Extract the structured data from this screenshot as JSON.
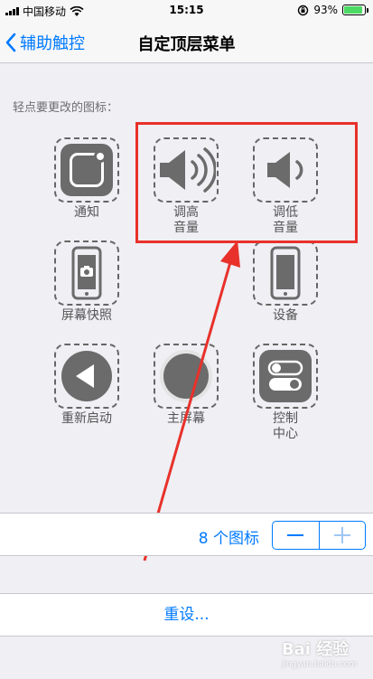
{
  "status_bar": {
    "carrier": "中国移动",
    "time": "15:15",
    "battery": "93%",
    "battery_level": 0.93
  },
  "nav": {
    "back_label": "辅助触控",
    "title": "自定顶层菜单"
  },
  "section_label": "轻点要更改的图标：",
  "icons": {
    "notification": "通知",
    "volume_up": "调高\n音量",
    "volume_down": "调低\n音量",
    "screenshot": "屏幕快照",
    "device": "设备",
    "restart": "重新启动",
    "home": "主屏幕",
    "control_center": "控制\n中心"
  },
  "counter": {
    "label": "8 个图标",
    "minus": "—",
    "plus": "+"
  },
  "reset": "重设...",
  "watermark": {
    "brand": "Bai 经验",
    "url": "jingyan.baidu.com"
  },
  "colors": {
    "accent": "#007aff",
    "highlight": "#e8312a",
    "tile": "#6b6b6b"
  }
}
